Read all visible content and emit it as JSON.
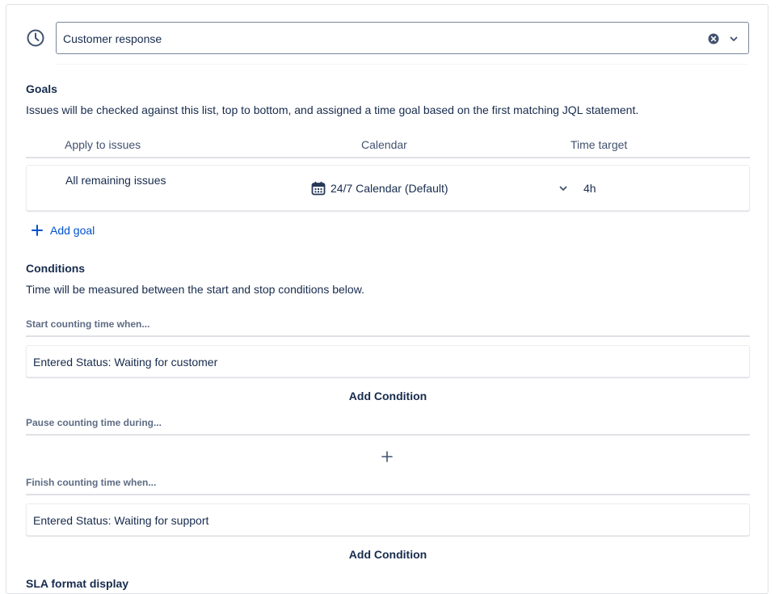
{
  "sla": {
    "name_value": "Customer response"
  },
  "goals": {
    "title": "Goals",
    "description": "Issues will be checked against this list, top to bottom, and assigned a time goal based on the first matching JQL statement.",
    "columns": [
      "Apply to issues",
      "Calendar",
      "Time target"
    ],
    "rows": [
      {
        "apply_to": "All remaining issues",
        "calendar": "24/7 Calendar (Default)",
        "time_target": "4h"
      }
    ],
    "add_goal_label": "Add goal"
  },
  "conditions": {
    "title": "Conditions",
    "description": "Time will be measured between the start and stop conditions below.",
    "start": {
      "label": "Start counting time when...",
      "items": [
        "Entered Status: Waiting for customer"
      ],
      "add_label": "Add Condition"
    },
    "pause": {
      "label": "Pause counting time during..."
    },
    "finish": {
      "label": "Finish counting time when...",
      "items": [
        "Entered Status: Waiting for support"
      ],
      "add_label": "Add Condition"
    }
  },
  "next_section_title": "SLA format display",
  "colors": {
    "link": "#0052cc",
    "text": "#172b4d",
    "subtle": "#5e6c84",
    "border": "#dfe1e6"
  },
  "icons": [
    "clock-icon",
    "clear-icon",
    "chevron-down-icon",
    "calendar-icon",
    "plus-icon"
  ]
}
